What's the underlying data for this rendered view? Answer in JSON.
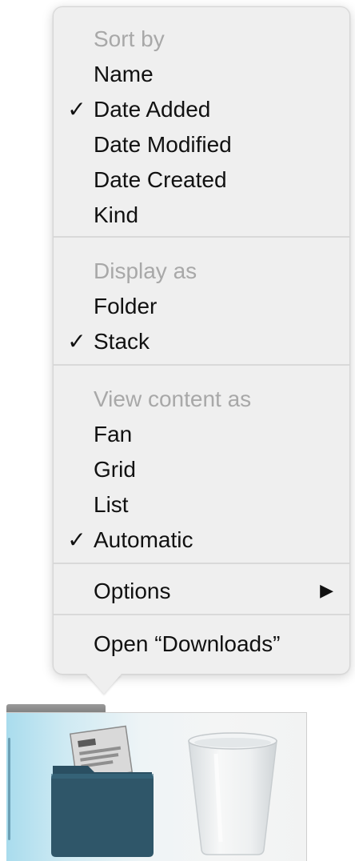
{
  "menu": {
    "sections": [
      {
        "header": "Sort by",
        "items": [
          {
            "label": "Name",
            "checked": false
          },
          {
            "label": "Date Added",
            "checked": true
          },
          {
            "label": "Date Modified",
            "checked": false
          },
          {
            "label": "Date Created",
            "checked": false
          },
          {
            "label": "Kind",
            "checked": false
          }
        ]
      },
      {
        "header": "Display as",
        "items": [
          {
            "label": "Folder",
            "checked": false
          },
          {
            "label": "Stack",
            "checked": true
          }
        ]
      },
      {
        "header": "View content as",
        "items": [
          {
            "label": "Fan",
            "checked": false
          },
          {
            "label": "Grid",
            "checked": false
          },
          {
            "label": "List",
            "checked": false
          },
          {
            "label": "Automatic",
            "checked": true
          }
        ]
      }
    ],
    "options_label": "Options",
    "open_label": "Open “Downloads”",
    "check_glyph": "✓",
    "submenu_arrow_glyph": "▶"
  },
  "dock": {
    "items": [
      {
        "name": "downloads-folder-icon"
      },
      {
        "name": "trash-icon"
      }
    ]
  },
  "colors": {
    "menu_background": "#efefef",
    "header_text": "#a8a8a8",
    "item_text": "#111111",
    "folder": "#2f5669"
  }
}
